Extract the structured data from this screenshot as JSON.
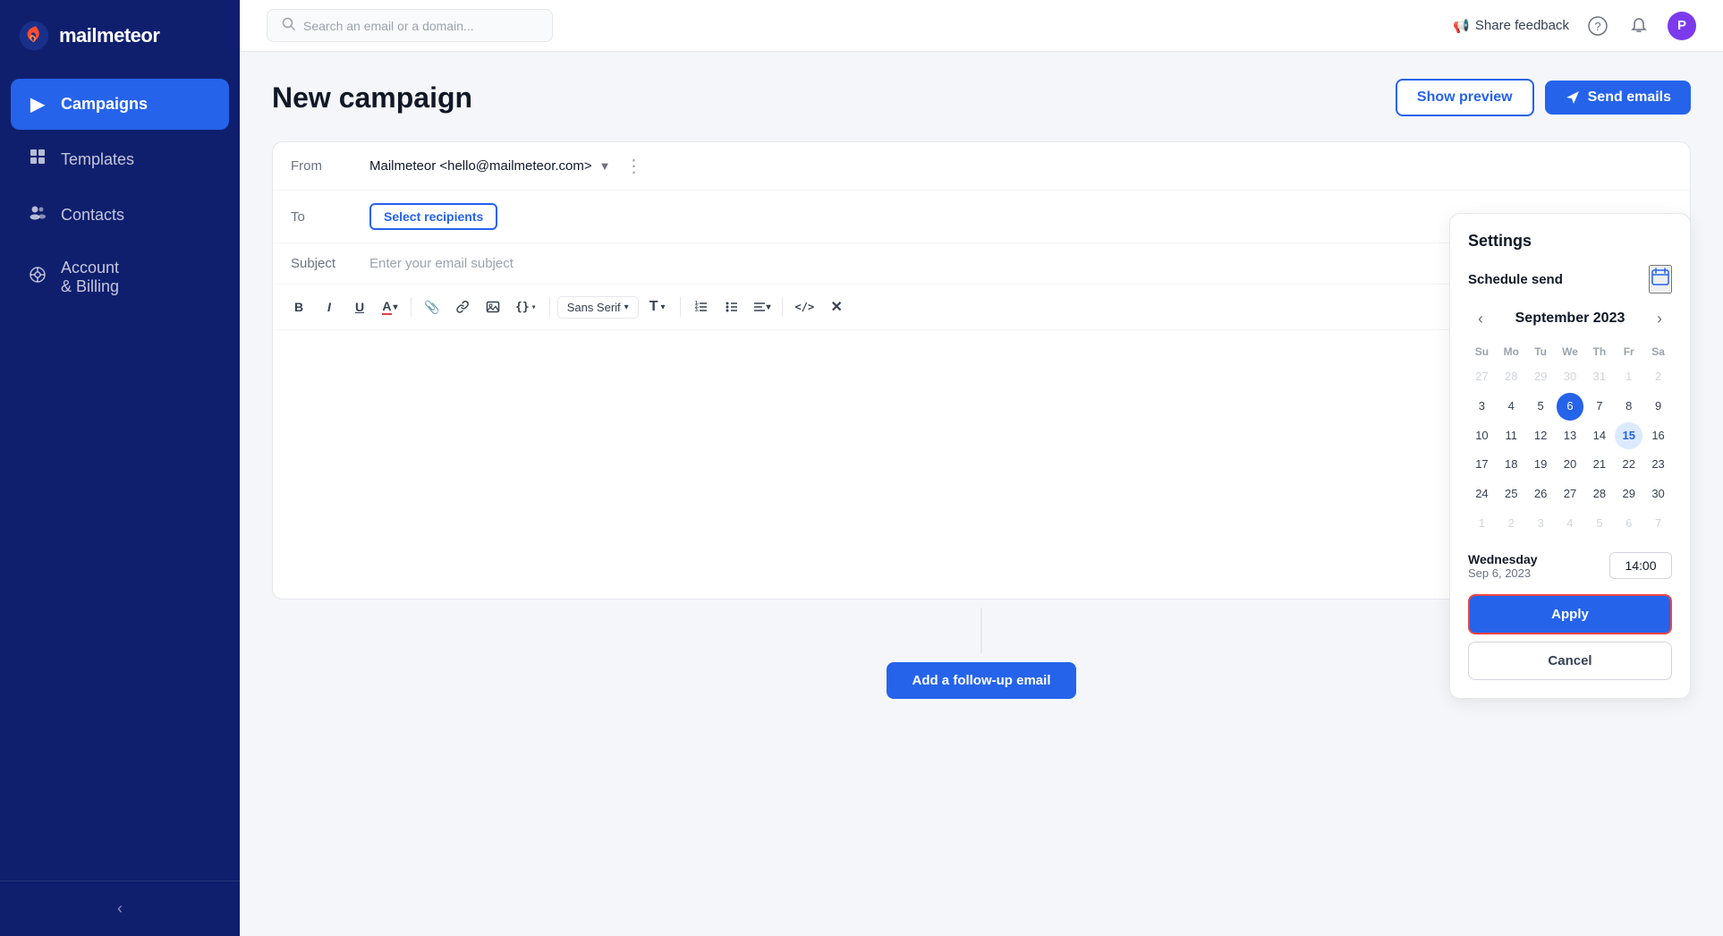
{
  "app": {
    "name": "mailmeteor"
  },
  "sidebar": {
    "items": [
      {
        "id": "campaigns",
        "label": "Campaigns",
        "icon": "▶",
        "active": true
      },
      {
        "id": "templates",
        "label": "Templates",
        "icon": "📄",
        "active": false
      },
      {
        "id": "contacts",
        "label": "Contacts",
        "icon": "👥",
        "active": false
      },
      {
        "id": "account-billing",
        "label": "Account\n& Billing",
        "label_line1": "Account",
        "label_line2": "& Billing",
        "icon": "⚙",
        "active": false
      }
    ],
    "collapse_label": "‹"
  },
  "topbar": {
    "search_placeholder": "Search an email or a domain...",
    "feedback_label": "Share feedback",
    "avatar_initials": "P"
  },
  "page": {
    "title": "New campaign"
  },
  "header_actions": {
    "preview_label": "Show preview",
    "send_label": "Send emails"
  },
  "composer": {
    "from_label": "From",
    "from_value": "Mailmeteor <hello@mailmeteor.com>",
    "to_label": "To",
    "select_recipients_label": "Select recipients",
    "subject_label": "Subject",
    "subject_placeholder": "Enter your email subject"
  },
  "toolbar": {
    "bold": "B",
    "italic": "I",
    "underline": "U",
    "color": "A",
    "attachment": "📎",
    "link": "🔗",
    "image": "🖼",
    "variables": "{}",
    "font_family": "Sans Serif",
    "text_size": "T",
    "ordered_list": "☰",
    "unordered_list": "≡",
    "align": "≡",
    "code": "</>",
    "clear": "✕"
  },
  "settings": {
    "title": "Settings",
    "schedule_label": "Schedule send",
    "calendar": {
      "month": "September 2023",
      "day_headers": [
        "Su",
        "Mo",
        "Tu",
        "We",
        "Th",
        "Fr",
        "Sa"
      ],
      "weeks": [
        [
          {
            "day": 27,
            "disabled": true
          },
          {
            "day": 28,
            "disabled": true
          },
          {
            "day": 29,
            "disabled": true
          },
          {
            "day": 30,
            "disabled": true
          },
          {
            "day": 31,
            "disabled": true
          },
          {
            "day": 1,
            "disabled": true
          },
          {
            "day": 2,
            "disabled": true
          }
        ],
        [
          {
            "day": 3
          },
          {
            "day": 4
          },
          {
            "day": 5
          },
          {
            "day": 6,
            "selected": true
          },
          {
            "day": 7
          },
          {
            "day": 8
          },
          {
            "day": 9
          }
        ],
        [
          {
            "day": 10
          },
          {
            "day": 11
          },
          {
            "day": 12
          },
          {
            "day": 13
          },
          {
            "day": 14
          },
          {
            "day": 15,
            "today": true
          },
          {
            "day": 16
          }
        ],
        [
          {
            "day": 17
          },
          {
            "day": 18
          },
          {
            "day": 19
          },
          {
            "day": 20
          },
          {
            "day": 21
          },
          {
            "day": 22
          },
          {
            "day": 23
          }
        ],
        [
          {
            "day": 24
          },
          {
            "day": 25
          },
          {
            "day": 26
          },
          {
            "day": 27
          },
          {
            "day": 28
          },
          {
            "day": 29
          },
          {
            "day": 30
          }
        ],
        [
          {
            "day": 1,
            "disabled": true
          },
          {
            "day": 2,
            "disabled": true
          },
          {
            "day": 3,
            "disabled": true
          },
          {
            "day": 4,
            "disabled": true
          },
          {
            "day": 5,
            "disabled": true
          },
          {
            "day": 6,
            "disabled": true
          },
          {
            "day": 7,
            "disabled": true
          }
        ]
      ]
    },
    "selected_day_label": "Wednesday",
    "selected_date_label": "Sep 6, 2023",
    "time_value": "14:00",
    "apply_label": "Apply",
    "cancel_label": "Cancel"
  },
  "add_followup_label": "Add a follow-up email"
}
